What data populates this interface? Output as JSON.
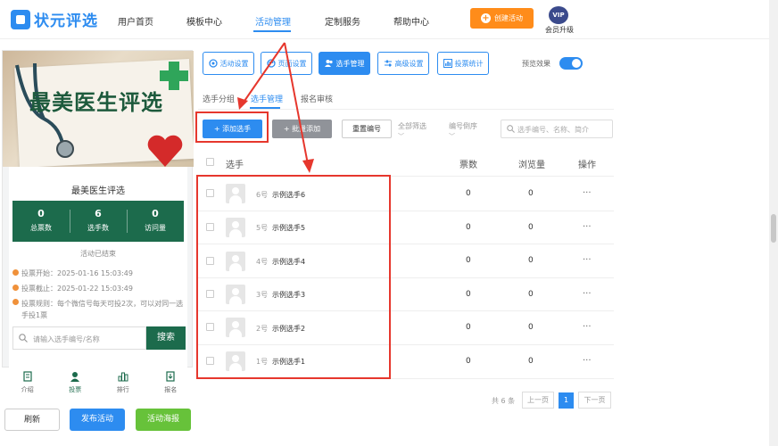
{
  "brand": {
    "name": "状元评选"
  },
  "nav": {
    "items": [
      "用户首页",
      "模板中心",
      "活动管理",
      "定制服务",
      "帮助中心"
    ],
    "create_label": "创建活动",
    "vip_badge": "VIP",
    "vip_label": "会员升级"
  },
  "preview": {
    "banner_title": "最美医生评选",
    "card_title": "最美医生评选",
    "stats": [
      {
        "value": "0",
        "label": "总票数"
      },
      {
        "value": "6",
        "label": "选手数"
      },
      {
        "value": "0",
        "label": "访问量"
      }
    ],
    "status": "活动已结束",
    "info": [
      "投票开始：2025-01-16 15:03:49",
      "投票截止：2025-01-22 15:03:49",
      "投票规则：每个微信号每天可投2次，可以对同一选手投1票"
    ],
    "search_placeholder": "请输入选手编号/名称",
    "search_button": "搜索",
    "bottom_nav": [
      "介绍",
      "投票",
      "排行",
      "报名"
    ]
  },
  "footer": {
    "refresh": "刷新",
    "publish": "发布活动",
    "poster": "活动海报"
  },
  "toolbar": {
    "buttons": [
      "活动设置",
      "页面设置",
      "选手管理",
      "高级设置",
      "投票统计"
    ],
    "preview_effect": "预览效果"
  },
  "subtabs": [
    "选手分组",
    "选手管理",
    "报名审核"
  ],
  "actions": {
    "add": "+ 添加选手",
    "batch": "+ 批量添加",
    "renumber": "重置编号",
    "filter": "全部筛选",
    "sort": "编号倒序",
    "search_placeholder": "选手编号、名称、简介"
  },
  "table": {
    "headers": [
      "选手",
      "票数",
      "浏览量",
      "操作"
    ],
    "rows": [
      {
        "num": "6号",
        "name": "示例选手6",
        "votes": "0",
        "views": "0",
        "more": "···"
      },
      {
        "num": "5号",
        "name": "示例选手5",
        "votes": "0",
        "views": "0",
        "more": "···"
      },
      {
        "num": "4号",
        "name": "示例选手4",
        "votes": "0",
        "views": "0",
        "more": "···"
      },
      {
        "num": "3号",
        "name": "示例选手3",
        "votes": "0",
        "views": "0",
        "more": "···"
      },
      {
        "num": "2号",
        "name": "示例选手2",
        "votes": "0",
        "views": "0",
        "more": "···"
      },
      {
        "num": "1号",
        "name": "示例选手1",
        "votes": "0",
        "views": "0",
        "more": "···"
      }
    ]
  },
  "pagination": {
    "total": "共 6 条",
    "prev": "上一页",
    "current": "1",
    "next": "下一页"
  },
  "colors": {
    "primary": "#2d8cf0",
    "accent": "#ff8c1a",
    "green": "#1c6b4c",
    "annotation": "#e6372d"
  }
}
